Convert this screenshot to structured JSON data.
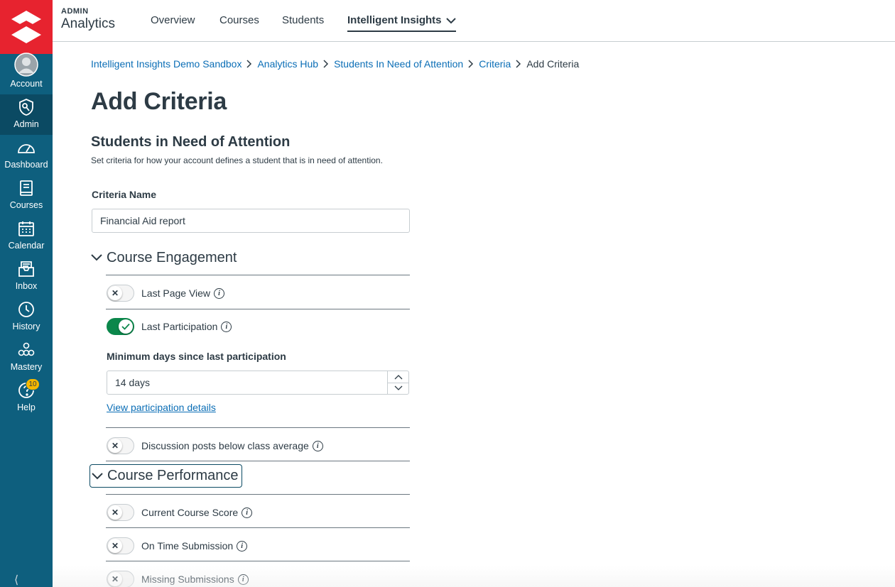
{
  "nav": {
    "items": [
      {
        "label": "Account",
        "icon": "avatar-icon"
      },
      {
        "label": "Admin",
        "icon": "admin-shield-icon"
      },
      {
        "label": "Dashboard",
        "icon": "dashboard-icon"
      },
      {
        "label": "Courses",
        "icon": "courses-icon"
      },
      {
        "label": "Calendar",
        "icon": "calendar-icon"
      },
      {
        "label": "Inbox",
        "icon": "inbox-icon"
      },
      {
        "label": "History",
        "icon": "history-icon"
      },
      {
        "label": "Mastery",
        "icon": "mastery-icon"
      },
      {
        "label": "Help",
        "icon": "help-icon",
        "badge": "10"
      }
    ]
  },
  "brand": {
    "top": "ADMIN",
    "name": "Analytics"
  },
  "topnav": {
    "overview": "Overview",
    "courses": "Courses",
    "students": "Students",
    "insights": "Intelligent Insights"
  },
  "breadcrumb": [
    "Intelligent Insights Demo Sandbox",
    "Analytics Hub",
    "Students In Need of Attention",
    "Criteria",
    "Add Criteria"
  ],
  "page": {
    "title": "Add Criteria",
    "section_title": "Students in Need of Attention",
    "section_desc": "Set criteria for how your account defines a student that is in need of attention."
  },
  "form": {
    "criteria_name_label": "Criteria Name",
    "criteria_name_value": "Financial Aid report",
    "engagement": {
      "title": "Course Engagement",
      "last_page_view": "Last Page View",
      "last_participation": "Last Participation",
      "min_days_label": "Minimum days since last participation",
      "min_days_value": "14 days",
      "view_details_link": "View participation details",
      "discussion_posts": "Discussion posts below class average"
    },
    "performance": {
      "title": "Course Performance",
      "current_score": "Current Course Score",
      "on_time": "On Time Submission",
      "missing": "Missing Submissions"
    }
  },
  "colors": {
    "nav_bg": "#0e5f7e",
    "logo_bg": "#e7232f",
    "link": "#0b6eb6",
    "toggle_on": "#0b874b",
    "badge": "#f5b700"
  }
}
